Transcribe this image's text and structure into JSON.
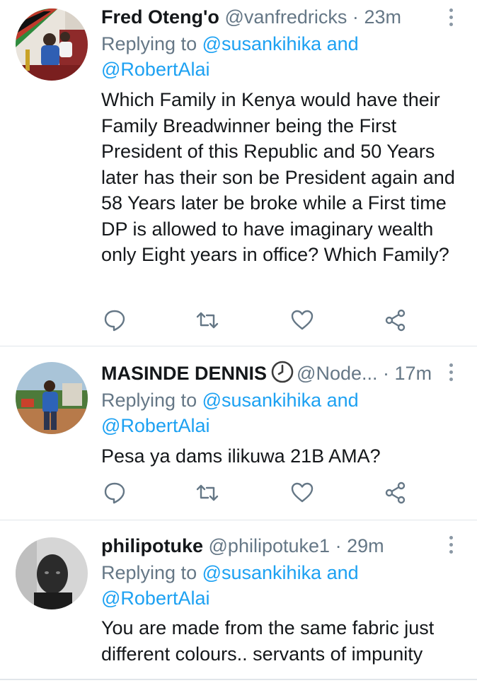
{
  "tweets": [
    {
      "name": "Fred Oteng'o",
      "handle": "@vanfredricks",
      "separator": "·",
      "time": "23m",
      "reply_prefix": "Replying to ",
      "reply_to_1": "@susankihika",
      "reply_and": " and",
      "reply_to_2": "@RobertAlai",
      "text": "Which Family in Kenya would have their Family Breadwinner being the First President of this Republic and 50 Years later has their son be President again and 58 Years later be broke while a First time DP is allowed to have imaginary wealth only Eight years in office? Which Family?"
    },
    {
      "name": "MASINDE DENNIS",
      "handle": "@Node...",
      "separator": "·",
      "time": "17m",
      "reply_prefix": "Replying to ",
      "reply_to_1": "@susankihika",
      "reply_and": " and",
      "reply_to_2": "@RobertAlai",
      "text": "Pesa ya dams ilikuwa 21B AMA?"
    },
    {
      "name": "philipotuke",
      "handle": "@philipotuke1",
      "separator": "·",
      "time": "29m",
      "reply_prefix": "Replying to ",
      "reply_to_1": "@susankihika",
      "reply_and": " and",
      "reply_to_2": "@RobertAlai",
      "text": "You are made from the same fabric just different colours.. servants of impunity"
    }
  ],
  "icons": {
    "reply": "reply-icon",
    "retweet": "retweet-icon",
    "like": "like-icon",
    "share": "share-icon",
    "more": "more-options-icon",
    "clock": "clock-emoji-icon"
  },
  "colors": {
    "link": "#1da1f2",
    "secondary_text": "#657786",
    "primary_text": "#14171a",
    "icon": "#657786",
    "divider": "#e1e6ea"
  }
}
